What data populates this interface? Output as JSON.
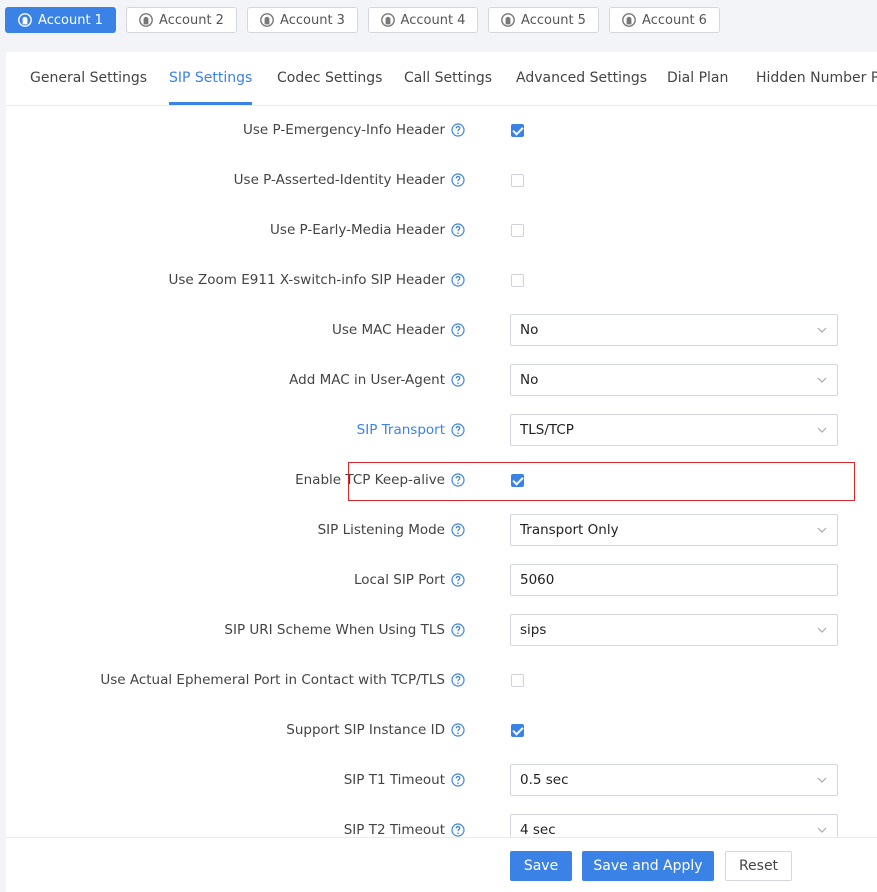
{
  "accounts": [
    {
      "label": "Account 1",
      "active": true
    },
    {
      "label": "Account 2",
      "active": false
    },
    {
      "label": "Account 3",
      "active": false
    },
    {
      "label": "Account 4",
      "active": false
    },
    {
      "label": "Account 5",
      "active": false
    },
    {
      "label": "Account 6",
      "active": false
    }
  ],
  "tabs": [
    {
      "label": "General Settings"
    },
    {
      "label": "SIP Settings",
      "active": true
    },
    {
      "label": "Codec Settings"
    },
    {
      "label": "Call Settings"
    },
    {
      "label": "Advanced Settings"
    },
    {
      "label": "Dial Plan"
    },
    {
      "label": "Hidden Number Pl"
    }
  ],
  "settings": [
    {
      "label": "Use P-Emergency-Info Header",
      "type": "checkbox",
      "checked": true
    },
    {
      "label": "Use P-Asserted-Identity Header",
      "type": "checkbox",
      "checked": false
    },
    {
      "label": "Use P-Early-Media Header",
      "type": "checkbox",
      "checked": false
    },
    {
      "label": "Use Zoom E911 X-switch-info SIP Header",
      "type": "checkbox",
      "checked": false
    },
    {
      "label": "Use MAC Header",
      "type": "select",
      "value": "No"
    },
    {
      "label": "Add MAC in User-Agent",
      "type": "select",
      "value": "No"
    },
    {
      "label": "SIP Transport",
      "type": "select",
      "value": "TLS/TCP",
      "highlighted": true
    },
    {
      "label": "Enable TCP Keep-alive",
      "type": "checkbox",
      "checked": true
    },
    {
      "label": "SIP Listening Mode",
      "type": "select",
      "value": "Transport Only"
    },
    {
      "label": "Local SIP Port",
      "type": "text",
      "value": "5060"
    },
    {
      "label": "SIP URI Scheme When Using TLS",
      "type": "select",
      "value": "sips"
    },
    {
      "label": "Use Actual Ephemeral Port in Contact with TCP/TLS",
      "type": "checkbox",
      "checked": false
    },
    {
      "label": "Support SIP Instance ID",
      "type": "checkbox",
      "checked": true
    },
    {
      "label": "SIP T1 Timeout",
      "type": "select",
      "value": "0.5 sec"
    },
    {
      "label": "SIP T2 Timeout",
      "type": "select",
      "value": "4 sec"
    }
  ],
  "footer": {
    "save_label": "Save",
    "save_apply_label": "Save and Apply",
    "reset_label": "Reset"
  },
  "icons": {
    "account": "user-circle-icon",
    "help": "question-circle-icon",
    "dropdown": "chevron-down-icon"
  },
  "colors": {
    "accent": "#3b82e6",
    "highlight_border": "#d9262c"
  }
}
